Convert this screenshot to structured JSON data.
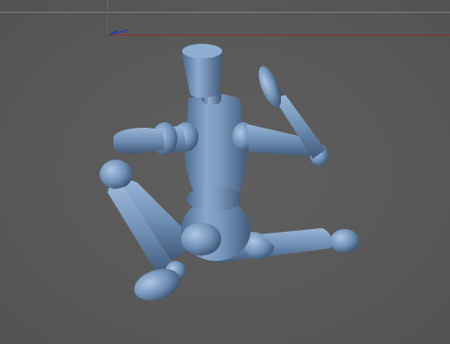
{
  "viewport": {
    "kind": "3d-viewport",
    "background": "#595959",
    "grid_horizon_color": "#7c7c7c",
    "axis_colors": {
      "x": "#9a2a2a",
      "y": "#1e9a1e",
      "z": "#2a3fb0"
    }
  },
  "model": {
    "name": "wooden-mannequin-figure",
    "pose": "seated-waving",
    "material_color": "#6f8fb5",
    "highlight_color": "#a9c2e0",
    "shadow_color": "#3d5573"
  }
}
